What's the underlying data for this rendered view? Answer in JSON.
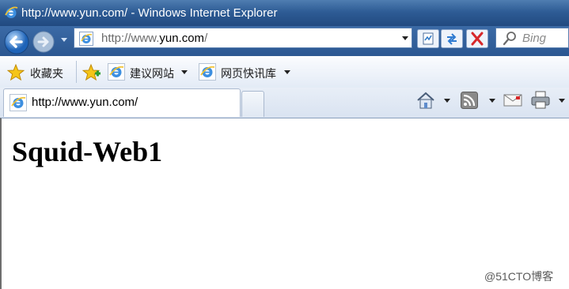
{
  "window": {
    "title": "http://www.yun.com/ - Windows Internet Explorer"
  },
  "address_bar": {
    "url_prefix": "http://www.",
    "url_domain": "yun.com",
    "url_suffix": "/"
  },
  "search": {
    "placeholder": "Bing"
  },
  "favorites_bar": {
    "favorites_label": "收藏夹",
    "items": [
      {
        "label": "建议网站",
        "icon": "ie-icon"
      },
      {
        "label": "网页快讯库",
        "icon": "ie-icon"
      }
    ]
  },
  "tabs": [
    {
      "label": "http://www.yun.com/",
      "icon": "ie-icon",
      "active": true
    }
  ],
  "command_bar": {
    "icons": [
      "home-icon",
      "rss-feed-icon",
      "mail-icon",
      "print-icon"
    ]
  },
  "page": {
    "heading": "Squid-Web1"
  },
  "watermark": "@51CTO博客",
  "colors": {
    "titlebar": "#2e5c95",
    "stop_red": "#d7282a",
    "rss_orange": "#e8891c"
  }
}
